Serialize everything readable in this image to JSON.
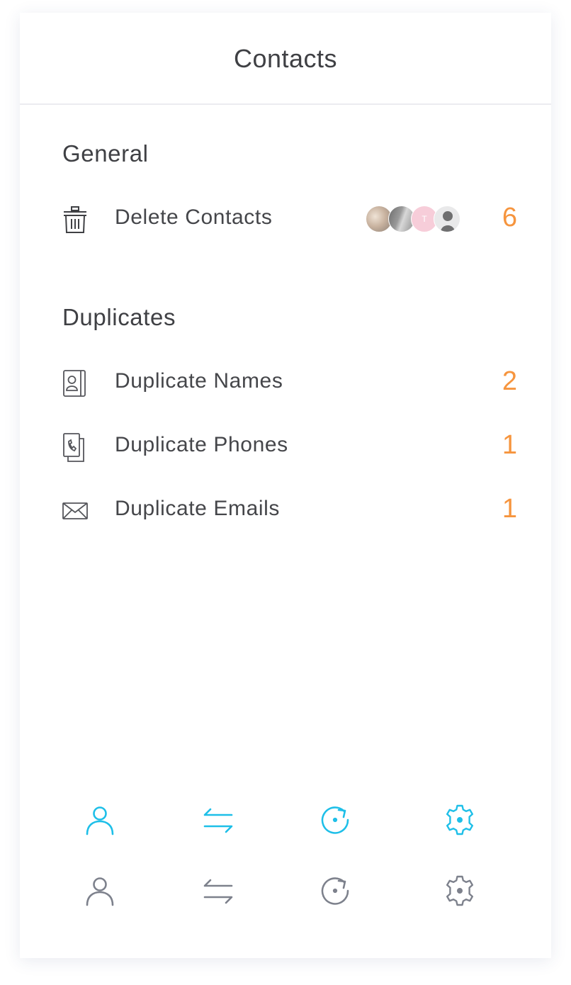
{
  "header": {
    "title": "Contacts"
  },
  "sections": {
    "general": {
      "title": "General",
      "items": [
        {
          "label": "Delete Contacts",
          "count": "6",
          "icon": "trash-icon",
          "avatar_initial": "T"
        }
      ]
    },
    "duplicates": {
      "title": "Duplicates",
      "items": [
        {
          "label": "Duplicate Names",
          "count": "2",
          "icon": "contact-card-icon"
        },
        {
          "label": "Duplicate Phones",
          "count": "1",
          "icon": "phone-duplicate-icon"
        },
        {
          "label": "Duplicate Emails",
          "count": "1",
          "icon": "envelope-icon"
        }
      ]
    }
  },
  "tabbars": [
    {
      "state": "active",
      "color": "#1ebfe8",
      "icons": [
        "person-icon",
        "swap-arrows-icon",
        "refresh-icon",
        "gear-icon"
      ]
    },
    {
      "state": "inactive",
      "color": "#7d818c",
      "icons": [
        "person-icon",
        "swap-arrows-icon",
        "refresh-icon",
        "gear-icon"
      ]
    }
  ],
  "colors": {
    "accent": "#1ebfe8",
    "count": "#f6953e",
    "text": "#3f4044",
    "inactive_icon": "#7d818c"
  }
}
